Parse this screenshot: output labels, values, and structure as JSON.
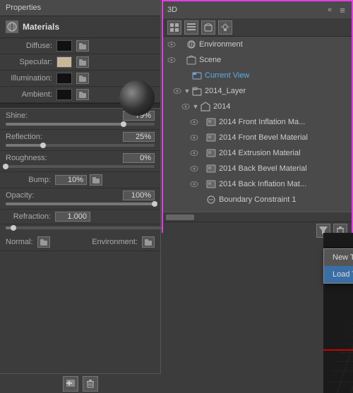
{
  "left_panel": {
    "header": "Properties",
    "materials_label": "Materials",
    "diffuse_label": "Diffuse:",
    "specular_label": "Specular:",
    "illumination_label": "Illumination:",
    "ambient_label": "Ambient:",
    "shine_label": "Shine:",
    "shine_value": "79%",
    "shine_percent": 79,
    "reflection_label": "Reflection:",
    "reflection_value": "25%",
    "reflection_percent": 25,
    "roughness_label": "Roughness:",
    "roughness_value": "0%",
    "roughness_percent": 0,
    "bump_label": "Bump:",
    "bump_value": "10%",
    "bump_percent": 10,
    "opacity_label": "Opacity:",
    "opacity_value": "100%",
    "opacity_percent": 100,
    "refraction_label": "Refraction:",
    "refraction_value": "1.000",
    "normal_label": "Normal:",
    "environment_label": "Environment:",
    "add_icon": "+",
    "delete_icon": "🗑"
  },
  "right_panel": {
    "title": "3D",
    "collapse_icon": "«",
    "menu_icon": "≡",
    "tree_items": [
      {
        "id": "environment",
        "label": "Environment",
        "indent": 0,
        "icon": "sun",
        "has_vis": true,
        "has_arrow": false
      },
      {
        "id": "scene",
        "label": "Scene",
        "indent": 0,
        "icon": "layers",
        "has_vis": true,
        "has_arrow": false
      },
      {
        "id": "current_view",
        "label": "Current View",
        "indent": 1,
        "icon": "folder",
        "has_vis": false,
        "has_arrow": false
      },
      {
        "id": "2014_layer",
        "label": "2014_Layer",
        "indent": 1,
        "icon": "folder",
        "has_vis": true,
        "has_arrow": true,
        "expanded": true
      },
      {
        "id": "2014",
        "label": "2014",
        "indent": 2,
        "icon": "folder",
        "has_vis": true,
        "has_arrow": true,
        "expanded": true
      },
      {
        "id": "front_inflation",
        "label": "2014 Front Inflation Ma...",
        "indent": 3,
        "icon": "material",
        "has_vis": true
      },
      {
        "id": "front_bevel",
        "label": "2014 Front Bevel Material",
        "indent": 3,
        "icon": "material",
        "has_vis": true
      },
      {
        "id": "extrusion",
        "label": "2014 Extrusion Material",
        "indent": 3,
        "icon": "material",
        "has_vis": true
      },
      {
        "id": "back_bevel",
        "label": "2014 Back Bevel Material",
        "indent": 3,
        "icon": "material",
        "has_vis": true
      },
      {
        "id": "back_inflation",
        "label": "2014 Back Inflation Mat...",
        "indent": 3,
        "icon": "material",
        "has_vis": true
      },
      {
        "id": "boundary1",
        "label": "Boundary Constraint 1",
        "indent": 3,
        "icon": "constraint",
        "has_vis": false
      }
    ],
    "context_menu": {
      "items": [
        {
          "id": "new_texture",
          "label": "New Texture..."
        },
        {
          "id": "load_texture",
          "label": "Load Texture..."
        }
      ]
    },
    "cursor_icon": "cursor"
  }
}
